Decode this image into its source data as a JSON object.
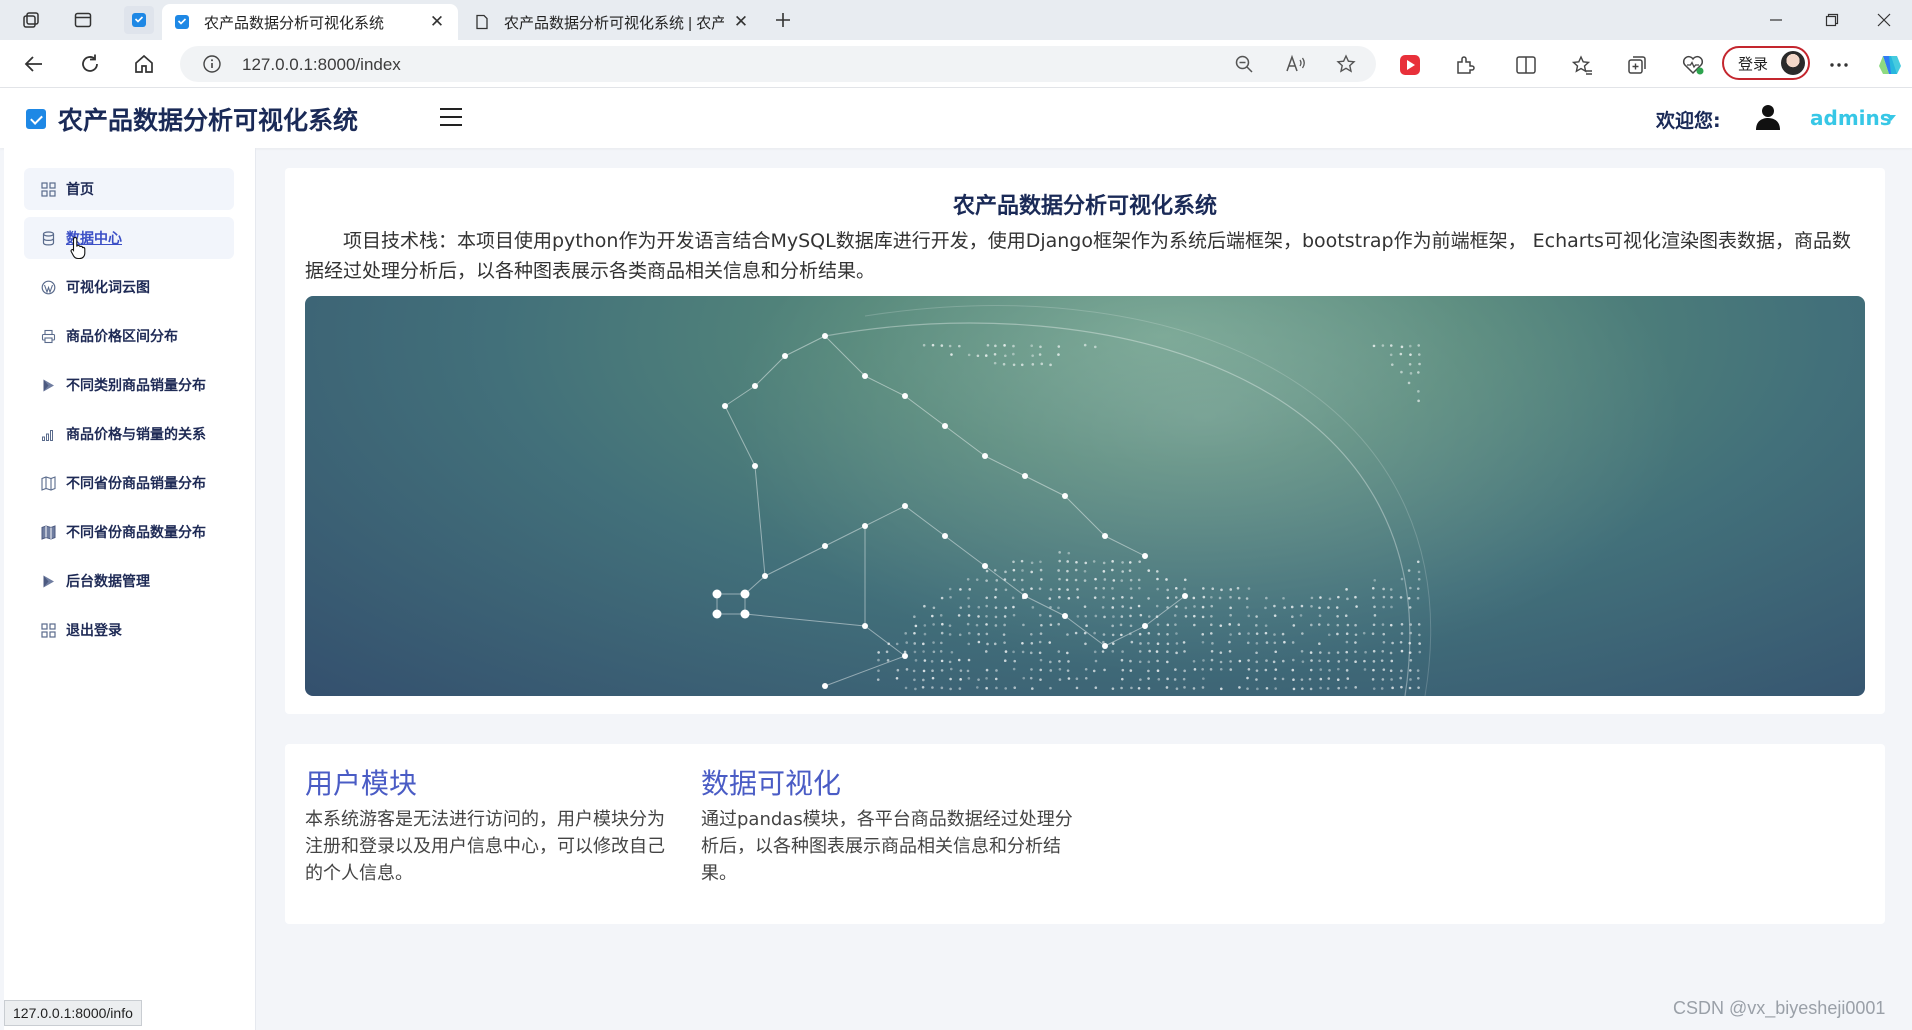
{
  "browser": {
    "tabs": [
      {
        "title": "农产品数据分析可视化系统",
        "active": true
      },
      {
        "title": "农产品数据分析可视化系统 | 农产",
        "active": false
      }
    ],
    "url": "127.0.0.1:8000/index",
    "login_label": "登录",
    "status_url": "127.0.0.1:8000/info"
  },
  "header": {
    "brand": "农产品数据分析可视化系统",
    "welcome": "欢迎您:",
    "username": "admins"
  },
  "sidebar": {
    "items": [
      {
        "label": "首页",
        "icon": "grid-icon"
      },
      {
        "label": "数据中心",
        "icon": "database-icon"
      },
      {
        "label": "可视化词云图",
        "icon": "wordpress-icon"
      },
      {
        "label": "商品价格区间分布",
        "icon": "printer-icon"
      },
      {
        "label": "不同类别商品销量分布",
        "icon": "play-icon"
      },
      {
        "label": "商品价格与销量的关系",
        "icon": "bar-chart-icon"
      },
      {
        "label": "不同省份商品销量分布",
        "icon": "map-icon"
      },
      {
        "label": "不同省份商品数量分布",
        "icon": "map-filled-icon"
      },
      {
        "label": "后台数据管理",
        "icon": "play-icon"
      },
      {
        "label": "退出登录",
        "icon": "grid-icon"
      }
    ]
  },
  "intro": {
    "title": "农产品数据分析可视化系统",
    "text": "项目技术栈：本项目使用python作为开发语言结合MySQL数据库进行开发，使用Django框架作为系统后端框架，bootstrap作为前端框架， Echarts可视化渲染图表数据，商品数据经过处理分析后，以各种图表展示各类商品相关信息和分析结果。"
  },
  "modules": [
    {
      "title": "用户模块",
      "text": "本系统游客是无法进行访问的，用户模块分为注册和登录以及用户信息中心，可以修改自己的个人信息。"
    },
    {
      "title": "数据可视化",
      "text": "通过pandas模块，各平台商品数据经过处理分析后，以各种图表展示商品相关信息和分析结果。"
    }
  ],
  "watermark": "CSDN @vx_biyesheji0001",
  "colors": {
    "accent": "#4a5cc5",
    "brand_dark": "#1a2a57",
    "username": "#37c7e6"
  }
}
